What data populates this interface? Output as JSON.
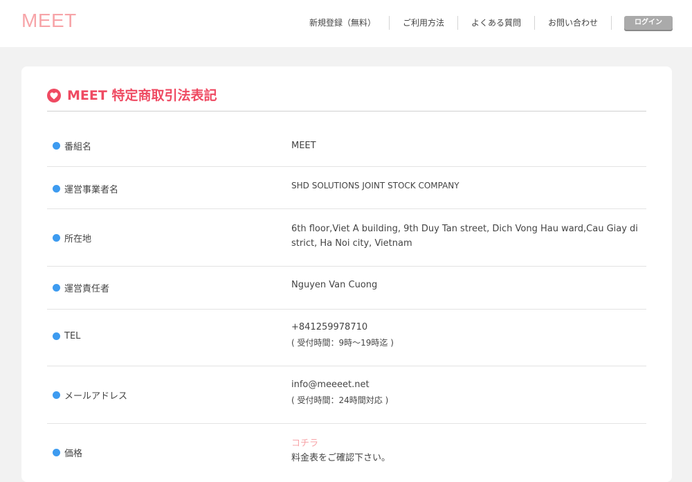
{
  "header": {
    "logo": "MEET",
    "nav": [
      {
        "label": "新規登録（無料）"
      },
      {
        "label": "ご利用方法"
      },
      {
        "label": "よくある質問"
      },
      {
        "label": "お問い合わせ"
      }
    ],
    "login_label": "ログイン"
  },
  "page": {
    "title": "MEET 特定商取引法表記"
  },
  "rows": [
    {
      "label": "番組名",
      "value": "MEET"
    },
    {
      "label": "運営事業者名",
      "value": "SHD SOLUTIONS JOINT STOCK COMPANY"
    },
    {
      "label": "所在地",
      "value_line1": "6th floor,Viet A building, 9th Duy Tan street, Dich Vong Hau ward,Cau Giay di",
      "value_line2": "strict, Ha Noi city, Vietnam"
    },
    {
      "label": "運営責任者",
      "value": "Nguyen Van Cuong"
    },
    {
      "label": "TEL",
      "value": "+841259978710",
      "note": "( 受付時間：9時〜19時迄 )"
    },
    {
      "label": "メールアドレス",
      "value": "info@meeeet.net",
      "note": "( 受付時間：24時間対応 )"
    },
    {
      "label": "価格",
      "link": "コチラ",
      "note": "料金表をご確認下さい。"
    }
  ],
  "colors": {
    "brand_pink": "#f7a4a8",
    "title_red": "#ef4a62",
    "bullet_blue": "#3d9bf0",
    "login_gray": "#aaaaaa"
  },
  "icons": {
    "title_icon": "heart-icon",
    "row_bullet": "dot-icon"
  }
}
